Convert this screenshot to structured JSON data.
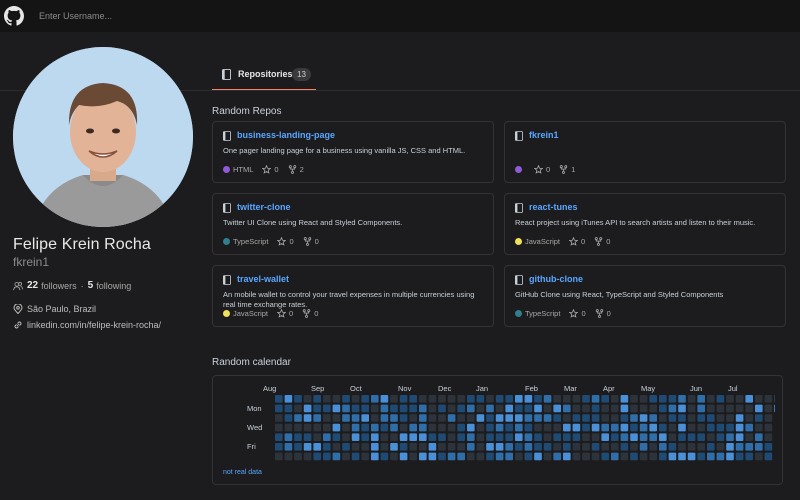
{
  "search": {
    "placeholder": "Enter Username..."
  },
  "tab": {
    "label": "Repositories",
    "count": "13"
  },
  "profile": {
    "name": "Felipe Krein Rocha",
    "username": "fkrein1",
    "followers_count": "22",
    "followers_label": "followers",
    "separator": "·",
    "following_count": "5",
    "following_label": "following",
    "location": "São Paulo, Brazil",
    "link": "linkedin.com/in/felipe-krein-rocha/"
  },
  "sections": {
    "repos_title": "Random Repos",
    "calendar_title": "Random calendar"
  },
  "repos": [
    {
      "name": "business-landing-page",
      "description": "One pager landing page for a business using vanilla JS, CSS and HTML.",
      "language": "HTML",
      "lang_color": "#8f5bd6",
      "stars": "0",
      "forks": "2"
    },
    {
      "name": "fkrein1",
      "description": "",
      "language": "",
      "lang_color": "#8f5bd6",
      "stars": "0",
      "forks": "1"
    },
    {
      "name": "twitter-clone",
      "description": "Twitter UI Clone using React and Styled Components.",
      "language": "TypeScript",
      "lang_color": "#2f7f8f",
      "stars": "0",
      "forks": "0"
    },
    {
      "name": "react-tunes",
      "description": "React project using iTunes API to search artists and listen to their music.",
      "language": "JavaScript",
      "lang_color": "#f1e05a",
      "stars": "0",
      "forks": "0"
    },
    {
      "name": "travel-wallet",
      "description": "An mobile wallet to control your travel expenses in multiple currencies using real time exchange rates.",
      "language": "JavaScript",
      "lang_color": "#f1e05a",
      "stars": "0",
      "forks": "0"
    },
    {
      "name": "github-clone",
      "description": "GitHub Clone using React, TypeScript and Styled Components",
      "language": "TypeScript",
      "lang_color": "#2f7f8f",
      "stars": "0",
      "forks": "0"
    }
  ],
  "calendar": {
    "months": [
      "Aug",
      "Sep",
      "Oct",
      "Nov",
      "Dec",
      "Jan",
      "Feb",
      "Mar",
      "Apr",
      "May",
      "Jun",
      "Jul"
    ],
    "weekdays": [
      "Mon",
      "Wed",
      "Fri"
    ],
    "note": "not real data",
    "level_colors": [
      "#2d333b",
      "#1f4a73",
      "#2f6ea8",
      "#4a90d9"
    ]
  },
  "colors": {
    "accent": "#58a6ff",
    "tab_underline": "#f78166",
    "background": "#1c1c1e"
  },
  "icons": {
    "logo": "github-logo-icon",
    "repo": "repo-book-icon",
    "star": "star-icon",
    "fork": "fork-icon",
    "people": "people-icon",
    "location": "location-pin-icon",
    "link": "link-icon"
  }
}
